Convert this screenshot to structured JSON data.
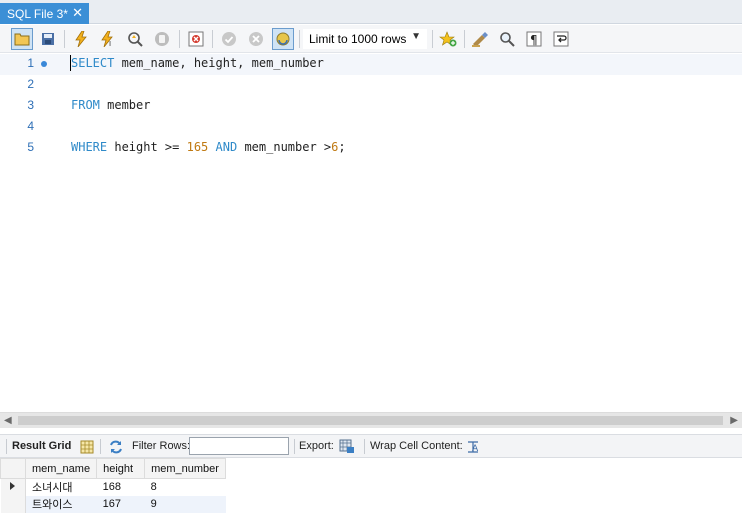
{
  "tab": {
    "title": "SQL File 3*",
    "close_glyph": "✕"
  },
  "toolbar": {
    "limit_label": "Limit to 1000 rows",
    "icons": [
      "open-folder-icon",
      "save-icon",
      "execute-icon",
      "execute-current-icon",
      "explain-icon",
      "stop-icon",
      "toggle-error-icon",
      "commit-icon",
      "rollback-icon",
      "autocommit-icon",
      "bookmark-add-icon",
      "beautify-icon",
      "find-icon",
      "invisible-chars-icon",
      "wrap-icon"
    ]
  },
  "editor": {
    "lines": [
      {
        "num": "1",
        "current": true
      },
      {
        "num": "2"
      },
      {
        "num": "3"
      },
      {
        "num": "4"
      },
      {
        "num": "5"
      }
    ],
    "line1": {
      "kw1": "SELECT",
      "rest": " mem_name, height, mem_number"
    },
    "line3": {
      "kw1": "FROM",
      "rest": " member"
    },
    "line5": {
      "kw1": "WHERE",
      "mid1": " height >= ",
      "num1": "165",
      "sp": " ",
      "kw2": "AND",
      "mid2": " mem_number >",
      "num2": "6",
      "end": ";"
    }
  },
  "result_toolbar": {
    "result_grid": "Result Grid",
    "filter_rows": "Filter Rows:",
    "filter_value": "",
    "export": "Export:",
    "wrap_cell": "Wrap Cell Content:"
  },
  "grid": {
    "columns": [
      "mem_name",
      "height",
      "mem_number"
    ],
    "rows": [
      [
        "소녀시대",
        "168",
        "8"
      ],
      [
        "트와이스",
        "167",
        "9"
      ]
    ]
  },
  "colors": {
    "accent": "#3b8fd6",
    "keyword": "#2f8ac9",
    "number": "#c07a13"
  }
}
